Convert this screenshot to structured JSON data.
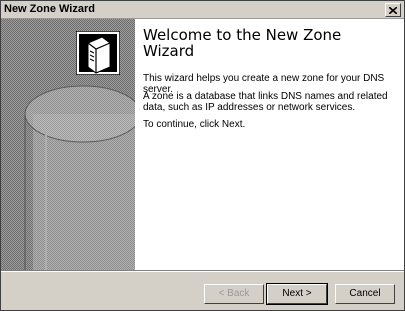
{
  "window": {
    "title": "New Zone Wizard"
  },
  "wizard": {
    "heading": "Welcome to the New Zone Wizard",
    "paragraphs": [
      "This wizard helps you create a new zone for your DNS server.",
      "A zone is a database that links DNS names and related data, such as IP addresses or network services.",
      "To continue, click Next."
    ]
  },
  "buttons": {
    "back": "< Back",
    "next": "Next >",
    "cancel": "Cancel"
  },
  "icons": {
    "close": "close-icon",
    "server": "server-icon"
  },
  "colors": {
    "panel": "#d4d0c8",
    "content_bg": "#ffffff",
    "sidebar_dark": "#7a7a7a"
  }
}
